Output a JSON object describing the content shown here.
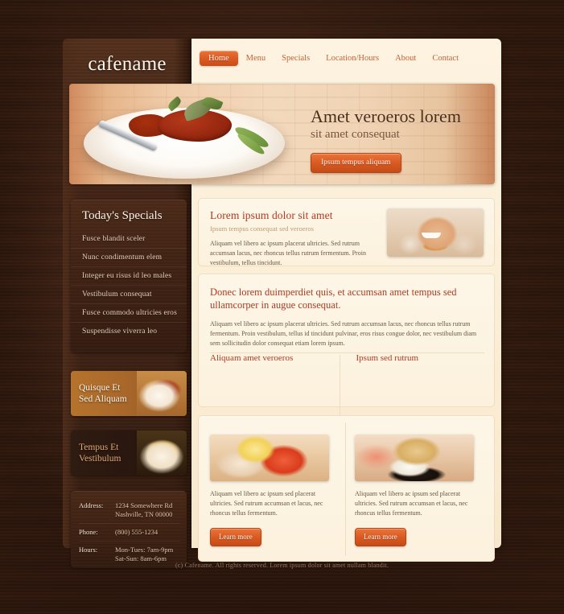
{
  "header": {
    "logo": "cafename",
    "nav": [
      {
        "label": "Home",
        "active": true
      },
      {
        "label": "Menu",
        "active": false
      },
      {
        "label": "Specials",
        "active": false
      },
      {
        "label": "Location/Hours",
        "active": false
      },
      {
        "label": "About",
        "active": false
      },
      {
        "label": "Contact",
        "active": false
      }
    ]
  },
  "hero": {
    "heading": "Amet veroeros lorem",
    "subheading": "sit amet consequat",
    "button": "Ipsum tempus aliquam",
    "image": "pasta-dish-photo"
  },
  "sidebar": {
    "specials": {
      "title": "Today's Specials",
      "items": [
        "Fusce blandit sceler",
        "Nunc condimentum elem",
        "Integer eu risus id leo males",
        "Vestibulum consequat",
        "Fusce commodo ultricies eros",
        "Suspendisse viverra leo"
      ]
    },
    "promos": [
      {
        "line1": "Quisque Et",
        "line2": "Sed Aliquam",
        "image": "pasta-promo-photo"
      },
      {
        "line1": "Tempus Et",
        "line2": "Vestibulum",
        "image": "noodle-promo-photo"
      }
    ],
    "contact": [
      {
        "key": "Address:",
        "value": "1234 Somewhere Rd\nNashville, TN 00000"
      },
      {
        "key": "Phone:",
        "value": "(800) 555-1234"
      },
      {
        "key": "Hours:",
        "value": "Mon-Tues: 7am-9pm\nSat-Sun: 8am-6pm"
      }
    ]
  },
  "main": {
    "card1": {
      "title": "Lorem ipsum dolor sit amet",
      "subtitle": "Ipsum tempus consequat sed veroeros",
      "body": "Aliquam vel libero ac ipsum placerat ultricies. Sed rutrum accumsan lacus, nec rhoncus tellus rutrum fermentum. Proin vestibulum, tellus tincidunt.",
      "image": "smiling-woman-photo"
    },
    "card2": {
      "title": "Donec lorem duimperdiet quis, et accumsan amet tempus sed ullamcorper in augue consequat.",
      "body": "Aliquam vel libero ac ipsum placerat ultricies. Sed rutrum accumsan lacus, nec rhoncus tellus rutrum fermentum. Proin vestibulum, tellus id tincidunt pulvinar, eros risus congue dolor, nec vestibulum diam sem sollicitudin dolor consequat etiam lorem ipsum."
    },
    "columns": [
      {
        "title": "Aliquam amet veroeros",
        "body": "Aliquam vel libero ac ipsum sed placerat ultricies. Sed rutrum accumsan et lacus, nec rhoncus tellus fermentum.",
        "button": "Learn more",
        "image": "shrimp-dish-photo"
      },
      {
        "title": "Ipsum sed rutrum",
        "body": "Aliquam vel libero ac ipsum sed placerat ultricies. Sed rutrum accumsan et lacus, nec rhoncus tellus fermentum.",
        "button": "Learn more",
        "image": "sushi-dish-photo"
      }
    ]
  },
  "footer": {
    "text": "(c) Cafename. All rights reserved. Lorem ipsum dolor sit amet nullam blandit."
  },
  "colors": {
    "accent": "#da5a22",
    "heading": "#b03a22",
    "page_bg": "#3a1f12",
    "panel_cream": "#fdf3e0",
    "sidebar_wood": "#3e2114"
  }
}
